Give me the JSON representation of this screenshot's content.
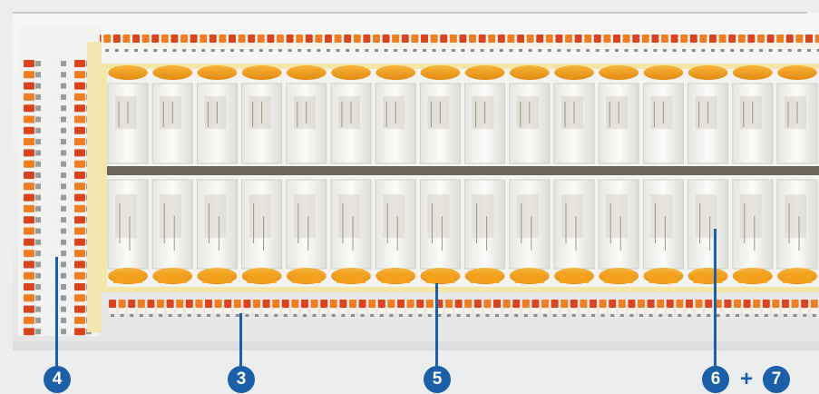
{
  "colors": {
    "background": "#ebedef",
    "board": "#f1f2f2",
    "relay_body": "#f6f6f4",
    "relay_label": "#d8d3c8",
    "socket_orange": "#f3a21c",
    "terminal_orange": "#ef7d22",
    "terminal_red": "#d9441f",
    "divider_dark": "#6b6458",
    "callout_blue": "#1a5fa8"
  },
  "relay_count": 32,
  "callouts": [
    {
      "id": "c4",
      "label": "4"
    },
    {
      "id": "c3",
      "label": "3"
    },
    {
      "id": "c5",
      "label": "5"
    },
    {
      "id": "c6",
      "label": "6"
    },
    {
      "id": "c7",
      "label": "7"
    }
  ],
  "plus_sign": "+"
}
